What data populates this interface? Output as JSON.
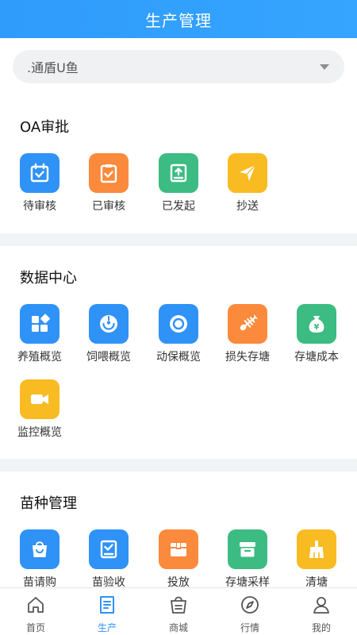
{
  "header": {
    "title": "生产管理"
  },
  "selector": {
    "value": ".通盾U鱼"
  },
  "sections": [
    {
      "title": "OA审批",
      "items": [
        {
          "label": "待审核",
          "icon": "calendar-check-icon",
          "color": "#2f92f6"
        },
        {
          "label": "已审核",
          "icon": "clipboard-check-icon",
          "color": "#fb8a3c"
        },
        {
          "label": "已发起",
          "icon": "upload-tray-icon",
          "color": "#3cbc82"
        },
        {
          "label": "抄送",
          "icon": "send-arrow-icon",
          "color": "#f8bb22"
        }
      ]
    },
    {
      "title": "数据中心",
      "items": [
        {
          "label": "养殖概览",
          "icon": "grid-shapes-icon",
          "color": "#2f92f6"
        },
        {
          "label": "饲喂概览",
          "icon": "feed-bowl-icon",
          "color": "#2f92f6"
        },
        {
          "label": "动保概览",
          "icon": "circle-ring-icon",
          "color": "#2f92f6"
        },
        {
          "label": "损失存塘",
          "icon": "fish-bone-icon",
          "color": "#fb8a3c"
        },
        {
          "label": "存塘成本",
          "icon": "money-bag-icon",
          "color": "#3cbc82"
        },
        {
          "label": "监控概览",
          "icon": "video-camera-icon",
          "color": "#f8bb22"
        }
      ]
    },
    {
      "title": "苗种管理",
      "items": [
        {
          "label": "苗请购",
          "icon": "shopping-bag-icon",
          "color": "#2f92f6"
        },
        {
          "label": "苗验收",
          "icon": "download-check-icon",
          "color": "#2f92f6"
        },
        {
          "label": "投放",
          "icon": "box-icon",
          "color": "#fb8a3c"
        },
        {
          "label": "存塘采样",
          "icon": "archive-icon",
          "color": "#3cbc82"
        },
        {
          "label": "清塘",
          "icon": "broom-icon",
          "color": "#f8bb22"
        }
      ]
    }
  ],
  "tabbar": {
    "active_color": "#2f92f6",
    "items": [
      {
        "label": "首页",
        "icon": "home-icon"
      },
      {
        "label": "生产",
        "icon": "document-icon"
      },
      {
        "label": "商城",
        "icon": "basket-icon"
      },
      {
        "label": "行情",
        "icon": "compass-icon"
      },
      {
        "label": "我的",
        "icon": "user-icon"
      }
    ]
  }
}
